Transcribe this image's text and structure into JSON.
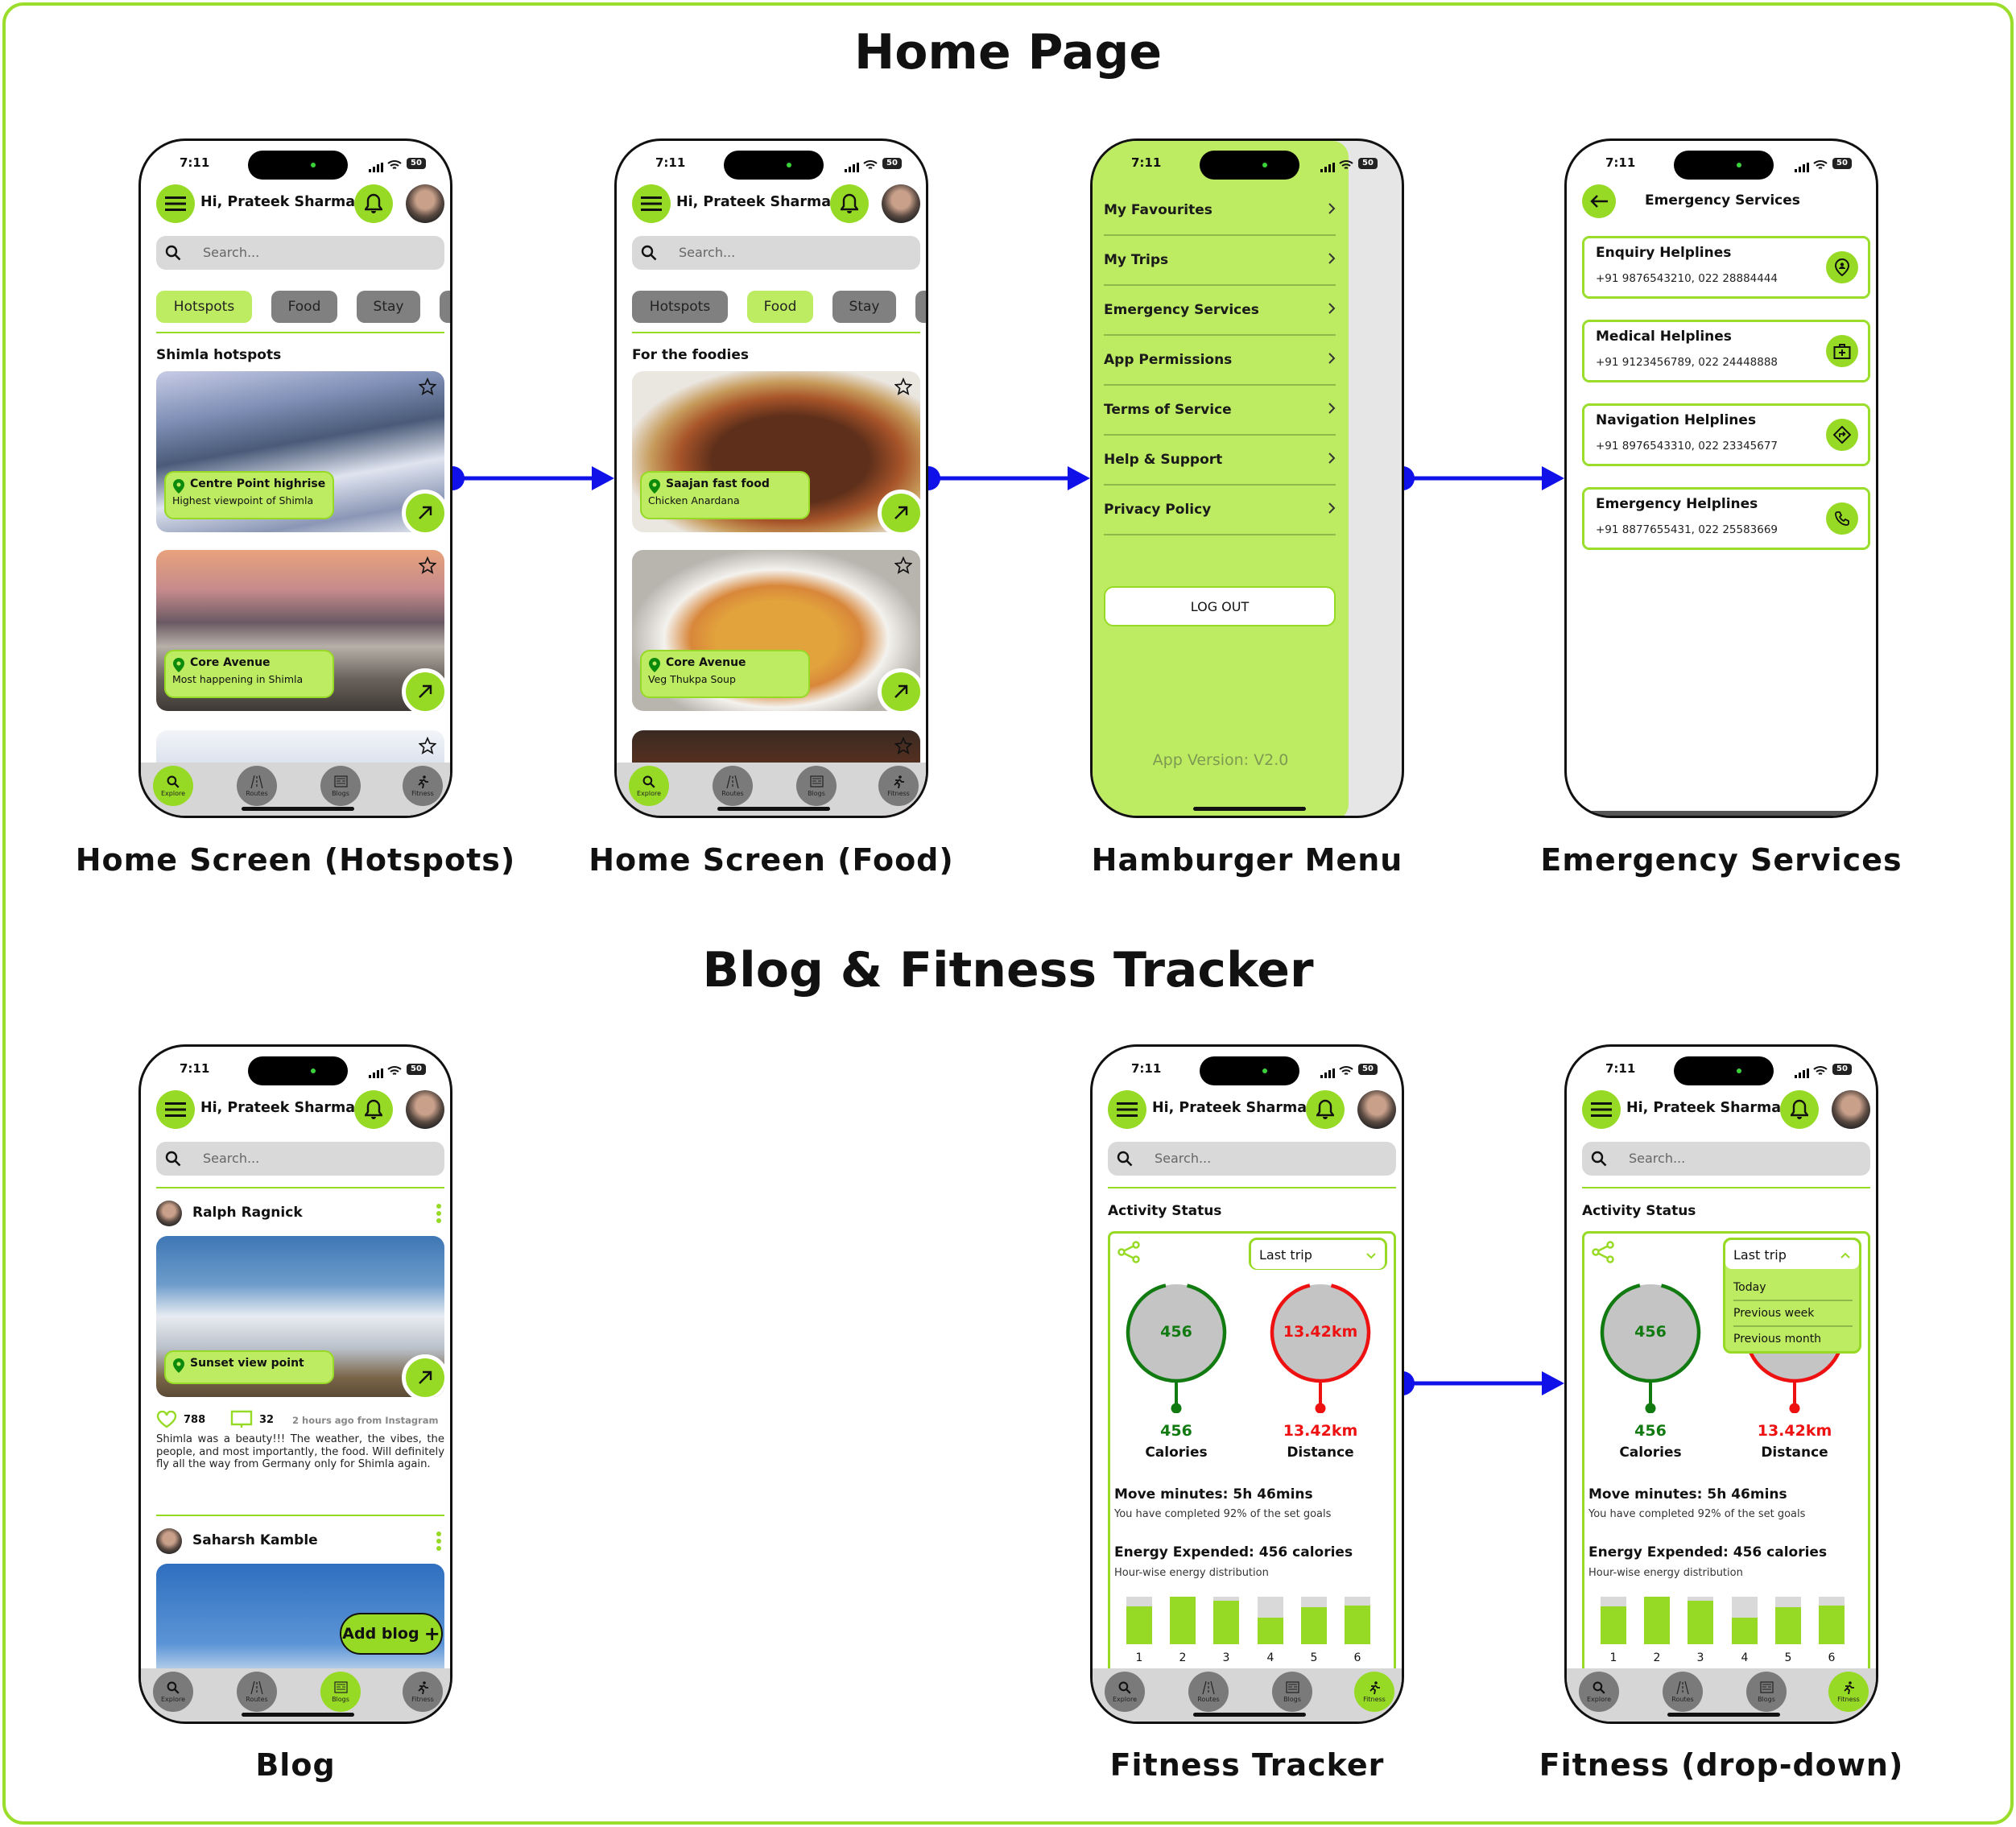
{
  "page": {
    "title_home": "Home Page",
    "title_blog": "Blog & Fitness Tracker"
  },
  "colors": {
    "accent": "#97DA25",
    "accent_light": "#BDEB62",
    "border": "#9ADE2B",
    "connector": "#1010e8",
    "calories": "#117a11",
    "distance": "#ee1111"
  },
  "status": {
    "time": "7:11",
    "battery": "50"
  },
  "header": {
    "greeting": "Hi, Prateek Sharma",
    "search_placeholder": "Search..."
  },
  "tabs": [
    "Hotspots",
    "Food",
    "Stay"
  ],
  "nav": [
    {
      "label": "Explore",
      "icon": "search-icon"
    },
    {
      "label": "Routes",
      "icon": "road-icon"
    },
    {
      "label": "Blogs",
      "icon": "newspaper-icon"
    },
    {
      "label": "Fitness",
      "icon": "running-icon"
    }
  ],
  "screens": {
    "hotspots": {
      "label": "Home Screen (Hotspots)",
      "section": "Shimla hotspots",
      "cards": [
        {
          "title": "Centre Point highrise",
          "subtitle": "Highest viewpoint of Shimla"
        },
        {
          "title": "Core Avenue",
          "subtitle": "Most happening in Shimla"
        }
      ]
    },
    "food": {
      "label": "Home Screen (Food)",
      "section": "For the foodies",
      "cards": [
        {
          "title": "Saajan fast food",
          "subtitle": "Chicken Anardana"
        },
        {
          "title": "Core Avenue",
          "subtitle": "Veg Thukpa Soup"
        }
      ]
    },
    "menu": {
      "label": "Hamburger Menu",
      "items": [
        "My Favourites",
        "My Trips",
        "Emergency Services",
        "App Permissions",
        "Terms of Service",
        "Help & Support",
        "Privacy Policy"
      ],
      "logout": "LOG OUT",
      "version": "App Version: V2.0"
    },
    "emergency": {
      "label": "Emergency Services",
      "title": "Emergency Services",
      "items": [
        {
          "title": "Enquiry Helplines",
          "numbers": "+91 9876543210,  022 28884444",
          "icon": "location-person-icon"
        },
        {
          "title": "Medical Helplines",
          "numbers": "+91 9123456789,  022 24448888",
          "icon": "first-aid-icon"
        },
        {
          "title": "Navigation Helplines",
          "numbers": "+91 8976543310,  022 23345677",
          "icon": "directions-icon"
        },
        {
          "title": "Emergency Helplines",
          "numbers": "+91 8877655431,  022 25583669",
          "icon": "phone-icon"
        }
      ]
    },
    "blog": {
      "label": "Blog",
      "add_blog": "Add blog",
      "posts": [
        {
          "author": "Ralph Ragnick",
          "location": "Sunset view point",
          "likes": "788",
          "comments": "32",
          "time": "2 hours ago from Instagram",
          "text": "Shimla was a beauty!!! The weather, the vibes, the people, and most importantly, the food. Will definitely fly all the way from Germany only for Shimla again."
        },
        {
          "author": "Saharsh Kamble"
        }
      ]
    },
    "fitness": {
      "label": "Fitness Tracker"
    },
    "fitness_dropdown": {
      "label": "Fitness (drop-down)",
      "options": [
        "Today",
        "Previous week",
        "Previous month"
      ]
    }
  },
  "activity": {
    "title": "Activity Status",
    "period": "Last trip",
    "calories_value": "456",
    "calories_label": "Calories",
    "distance_value": "13.42km",
    "distance_label": "Distance",
    "move": "Move minutes: 5h 46mins",
    "move_sub": "You have completed 92% of the set goals",
    "energy": "Energy Expended: 456 calories",
    "energy_sub": "Hour-wise energy distribution",
    "energy_distribution": {
      "type": "bar",
      "categories": [
        "1",
        "2",
        "3",
        "4",
        "5",
        "6"
      ],
      "values": [
        0.8,
        1.0,
        0.91,
        0.56,
        0.78,
        0.82
      ]
    }
  }
}
